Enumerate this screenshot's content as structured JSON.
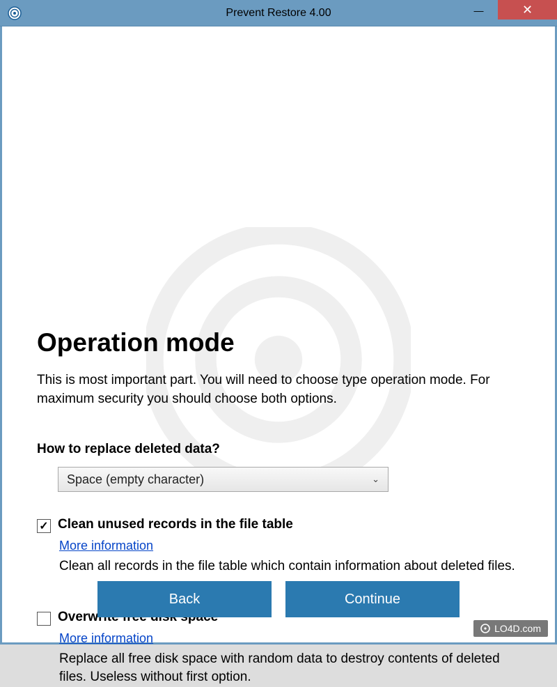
{
  "window": {
    "title": "Prevent Restore 4.00",
    "minimize": "—",
    "close": "✕"
  },
  "page": {
    "heading": "Operation mode",
    "intro": "This is most important part. You will need to choose type operation mode. For maximum security you should choose both options.",
    "question": "How to replace deleted data?",
    "dropdown_value": "Space (empty character)"
  },
  "options": [
    {
      "checked": true,
      "label": "Clean unused records in the file table",
      "more": "More information",
      "desc": "Clean all records in the file table which contain information about deleted files."
    },
    {
      "checked": false,
      "label": "Overwrite free disk space",
      "more": "More information",
      "desc": "Replace all free disk space with random data to destroy contents of deleted files. Useless without first option."
    }
  ],
  "buttons": {
    "back": "Back",
    "continue": "Continue"
  },
  "watermark": "LO4D.com"
}
